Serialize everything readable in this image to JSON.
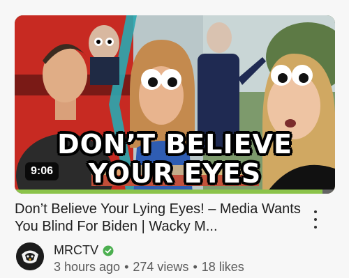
{
  "thumbnail": {
    "headline_line1": "DON’T BELIEVE",
    "headline_line2": "YOUR EYES",
    "duration": "9:06",
    "progress_fraction": 0.96,
    "progress_color": "#8bc34a"
  },
  "video": {
    "title": "Don’t Believe Your Lying Eyes! – Media Wants You Blind For Biden | Wacky M..."
  },
  "channel": {
    "name": "MRCTV",
    "verified_color": "#4caf50"
  },
  "meta": {
    "uploaded": "3 hours ago",
    "views": "274 views",
    "likes": "18 likes",
    "separator": "•"
  },
  "icons": {
    "menu": "more-vert-icon",
    "verified": "check-circle-icon",
    "avatar": "mrctv-eagle-logo"
  }
}
